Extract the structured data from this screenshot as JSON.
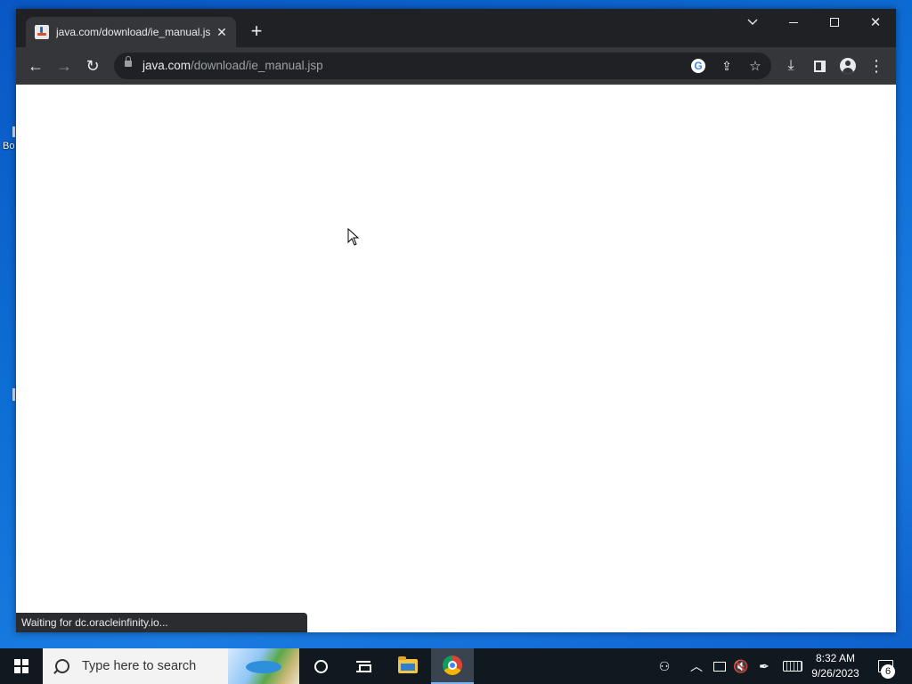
{
  "desktop": {
    "fragment_label": "Bo"
  },
  "browser": {
    "tab": {
      "title": "java.com/download/ie_manual.jsp",
      "favicon": "java-icon",
      "close_glyph": "✕"
    },
    "new_tab_glyph": "+",
    "window_controls": {
      "close_glyph": "✕"
    },
    "nav": {
      "back_glyph": "←",
      "forward_glyph": "→",
      "reload_glyph": "↻"
    },
    "address": {
      "host": "java.com",
      "path": "/download/ie_manual.jsp"
    },
    "omnibox_icons": [
      "google-lens-icon",
      "share-icon",
      "bookmark-star-icon"
    ],
    "star_glyph": "☆",
    "share_glyph": "⇪",
    "toolbar_icons": [
      "download-icon",
      "side-panel-icon",
      "profile-icon",
      "menu-icon"
    ],
    "download_glyph": "⤓",
    "menu_glyph": "⋮",
    "status": "Waiting for dc.oracleinfinity.io..."
  },
  "taskbar": {
    "search_placeholder": "Type here to search",
    "apps": [
      "cortana",
      "task-view",
      "file-explorer",
      "chrome"
    ],
    "tray": {
      "people_glyph": "⚇",
      "chevron_glyph": "︿",
      "volume_glyph": "🔇",
      "pen_glyph": "✒"
    },
    "clock": {
      "time": "8:32 AM",
      "date": "9/26/2023"
    },
    "notification_count": "6"
  },
  "colors": {
    "titlebar": "#202124",
    "toolbar": "#35363a",
    "taskbar": "#101820",
    "desktop": "#0d6fd6"
  }
}
